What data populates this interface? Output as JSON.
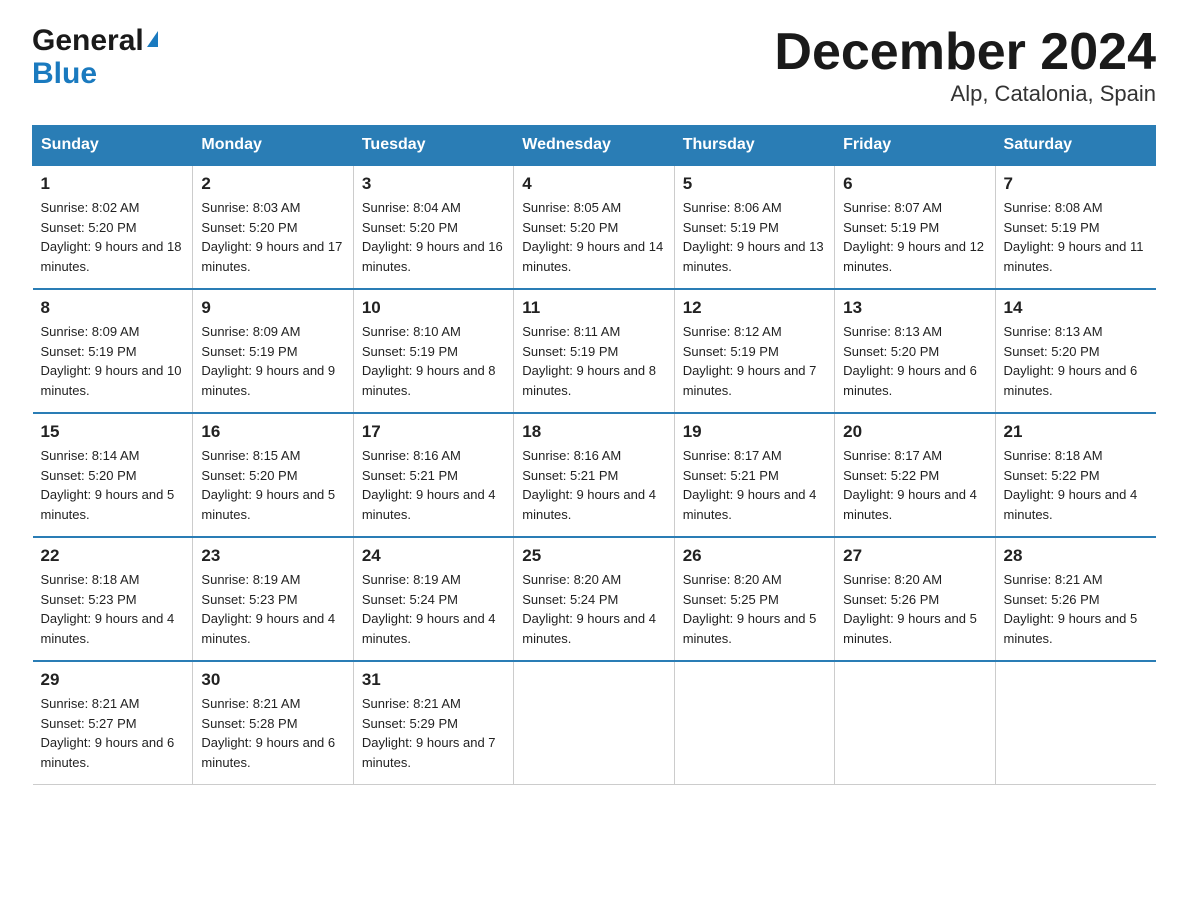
{
  "logo": {
    "line1": "General",
    "line2": "Blue",
    "triangle": "▶"
  },
  "title": "December 2024",
  "subtitle": "Alp, Catalonia, Spain",
  "weekdays": [
    "Sunday",
    "Monday",
    "Tuesday",
    "Wednesday",
    "Thursday",
    "Friday",
    "Saturday"
  ],
  "weeks": [
    [
      {
        "day": "1",
        "sunrise": "Sunrise: 8:02 AM",
        "sunset": "Sunset: 5:20 PM",
        "daylight": "Daylight: 9 hours and 18 minutes."
      },
      {
        "day": "2",
        "sunrise": "Sunrise: 8:03 AM",
        "sunset": "Sunset: 5:20 PM",
        "daylight": "Daylight: 9 hours and 17 minutes."
      },
      {
        "day": "3",
        "sunrise": "Sunrise: 8:04 AM",
        "sunset": "Sunset: 5:20 PM",
        "daylight": "Daylight: 9 hours and 16 minutes."
      },
      {
        "day": "4",
        "sunrise": "Sunrise: 8:05 AM",
        "sunset": "Sunset: 5:20 PM",
        "daylight": "Daylight: 9 hours and 14 minutes."
      },
      {
        "day": "5",
        "sunrise": "Sunrise: 8:06 AM",
        "sunset": "Sunset: 5:19 PM",
        "daylight": "Daylight: 9 hours and 13 minutes."
      },
      {
        "day": "6",
        "sunrise": "Sunrise: 8:07 AM",
        "sunset": "Sunset: 5:19 PM",
        "daylight": "Daylight: 9 hours and 12 minutes."
      },
      {
        "day": "7",
        "sunrise": "Sunrise: 8:08 AM",
        "sunset": "Sunset: 5:19 PM",
        "daylight": "Daylight: 9 hours and 11 minutes."
      }
    ],
    [
      {
        "day": "8",
        "sunrise": "Sunrise: 8:09 AM",
        "sunset": "Sunset: 5:19 PM",
        "daylight": "Daylight: 9 hours and 10 minutes."
      },
      {
        "day": "9",
        "sunrise": "Sunrise: 8:09 AM",
        "sunset": "Sunset: 5:19 PM",
        "daylight": "Daylight: 9 hours and 9 minutes."
      },
      {
        "day": "10",
        "sunrise": "Sunrise: 8:10 AM",
        "sunset": "Sunset: 5:19 PM",
        "daylight": "Daylight: 9 hours and 8 minutes."
      },
      {
        "day": "11",
        "sunrise": "Sunrise: 8:11 AM",
        "sunset": "Sunset: 5:19 PM",
        "daylight": "Daylight: 9 hours and 8 minutes."
      },
      {
        "day": "12",
        "sunrise": "Sunrise: 8:12 AM",
        "sunset": "Sunset: 5:19 PM",
        "daylight": "Daylight: 9 hours and 7 minutes."
      },
      {
        "day": "13",
        "sunrise": "Sunrise: 8:13 AM",
        "sunset": "Sunset: 5:20 PM",
        "daylight": "Daylight: 9 hours and 6 minutes."
      },
      {
        "day": "14",
        "sunrise": "Sunrise: 8:13 AM",
        "sunset": "Sunset: 5:20 PM",
        "daylight": "Daylight: 9 hours and 6 minutes."
      }
    ],
    [
      {
        "day": "15",
        "sunrise": "Sunrise: 8:14 AM",
        "sunset": "Sunset: 5:20 PM",
        "daylight": "Daylight: 9 hours and 5 minutes."
      },
      {
        "day": "16",
        "sunrise": "Sunrise: 8:15 AM",
        "sunset": "Sunset: 5:20 PM",
        "daylight": "Daylight: 9 hours and 5 minutes."
      },
      {
        "day": "17",
        "sunrise": "Sunrise: 8:16 AM",
        "sunset": "Sunset: 5:21 PM",
        "daylight": "Daylight: 9 hours and 4 minutes."
      },
      {
        "day": "18",
        "sunrise": "Sunrise: 8:16 AM",
        "sunset": "Sunset: 5:21 PM",
        "daylight": "Daylight: 9 hours and 4 minutes."
      },
      {
        "day": "19",
        "sunrise": "Sunrise: 8:17 AM",
        "sunset": "Sunset: 5:21 PM",
        "daylight": "Daylight: 9 hours and 4 minutes."
      },
      {
        "day": "20",
        "sunrise": "Sunrise: 8:17 AM",
        "sunset": "Sunset: 5:22 PM",
        "daylight": "Daylight: 9 hours and 4 minutes."
      },
      {
        "day": "21",
        "sunrise": "Sunrise: 8:18 AM",
        "sunset": "Sunset: 5:22 PM",
        "daylight": "Daylight: 9 hours and 4 minutes."
      }
    ],
    [
      {
        "day": "22",
        "sunrise": "Sunrise: 8:18 AM",
        "sunset": "Sunset: 5:23 PM",
        "daylight": "Daylight: 9 hours and 4 minutes."
      },
      {
        "day": "23",
        "sunrise": "Sunrise: 8:19 AM",
        "sunset": "Sunset: 5:23 PM",
        "daylight": "Daylight: 9 hours and 4 minutes."
      },
      {
        "day": "24",
        "sunrise": "Sunrise: 8:19 AM",
        "sunset": "Sunset: 5:24 PM",
        "daylight": "Daylight: 9 hours and 4 minutes."
      },
      {
        "day": "25",
        "sunrise": "Sunrise: 8:20 AM",
        "sunset": "Sunset: 5:24 PM",
        "daylight": "Daylight: 9 hours and 4 minutes."
      },
      {
        "day": "26",
        "sunrise": "Sunrise: 8:20 AM",
        "sunset": "Sunset: 5:25 PM",
        "daylight": "Daylight: 9 hours and 5 minutes."
      },
      {
        "day": "27",
        "sunrise": "Sunrise: 8:20 AM",
        "sunset": "Sunset: 5:26 PM",
        "daylight": "Daylight: 9 hours and 5 minutes."
      },
      {
        "day": "28",
        "sunrise": "Sunrise: 8:21 AM",
        "sunset": "Sunset: 5:26 PM",
        "daylight": "Daylight: 9 hours and 5 minutes."
      }
    ],
    [
      {
        "day": "29",
        "sunrise": "Sunrise: 8:21 AM",
        "sunset": "Sunset: 5:27 PM",
        "daylight": "Daylight: 9 hours and 6 minutes."
      },
      {
        "day": "30",
        "sunrise": "Sunrise: 8:21 AM",
        "sunset": "Sunset: 5:28 PM",
        "daylight": "Daylight: 9 hours and 6 minutes."
      },
      {
        "day": "31",
        "sunrise": "Sunrise: 8:21 AM",
        "sunset": "Sunset: 5:29 PM",
        "daylight": "Daylight: 9 hours and 7 minutes."
      },
      {
        "day": "",
        "sunrise": "",
        "sunset": "",
        "daylight": ""
      },
      {
        "day": "",
        "sunrise": "",
        "sunset": "",
        "daylight": ""
      },
      {
        "day": "",
        "sunrise": "",
        "sunset": "",
        "daylight": ""
      },
      {
        "day": "",
        "sunrise": "",
        "sunset": "",
        "daylight": ""
      }
    ]
  ]
}
